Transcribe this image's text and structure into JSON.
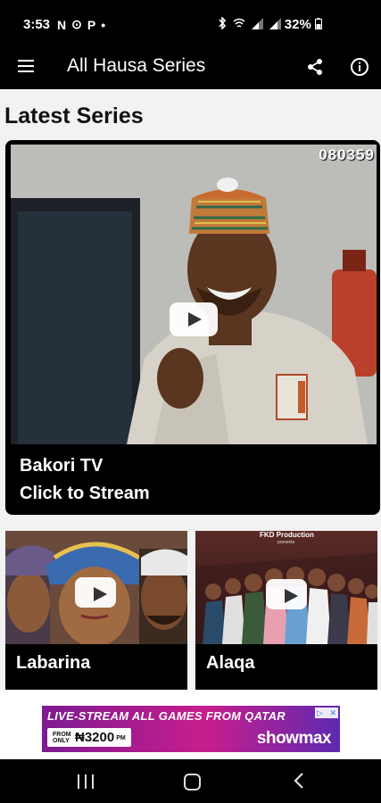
{
  "status_bar": {
    "time": "3:53",
    "icons_left": [
      "N",
      "⊙",
      "P",
      "•"
    ],
    "battery": "32%"
  },
  "app_bar": {
    "title": "All Hausa Series"
  },
  "section": {
    "title": "Latest Series"
  },
  "hero": {
    "title": "Bakori TV",
    "subtitle": "Click to Stream",
    "watermark": "080359"
  },
  "cards": [
    {
      "label": "Labarina"
    },
    {
      "label": "Alaqa",
      "thumb_text": "FKD Production",
      "thumb_subtext": "presents"
    }
  ],
  "ad": {
    "headline": "LIVE-STREAM ALL GAMES FROM QATAR",
    "price_prefix": "FROM ONLY",
    "price": "₦3200",
    "price_suffix": "PM",
    "brand": "showmax"
  },
  "colors": {
    "background": "#f2f2f2",
    "bars": "#000000",
    "ad_accent": "#c81d8d"
  }
}
